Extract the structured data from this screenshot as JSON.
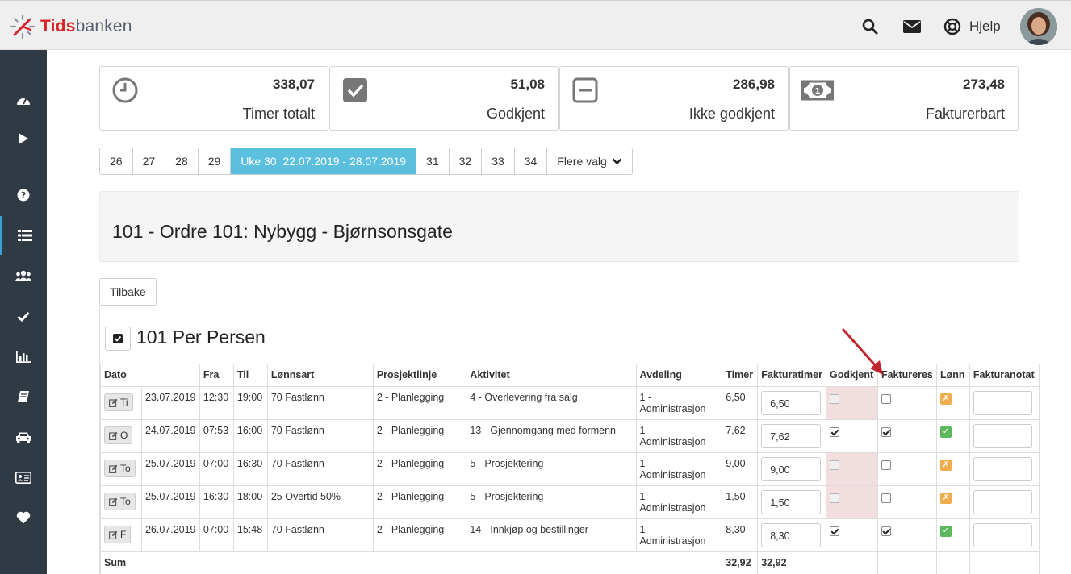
{
  "header": {
    "logo_brand": "Tids",
    "logo_rest": "banken",
    "help_label": "Hjelp",
    "icons": [
      "search-icon",
      "envelope-icon",
      "lifebuoy-icon"
    ]
  },
  "sidebar": {
    "items": [
      "dashboard-icon",
      "play-icon",
      "question-icon",
      "list-icon",
      "users-icon",
      "check-icon",
      "bar-chart-icon",
      "book-icon",
      "car-icon",
      "id-card-icon",
      "heart-icon"
    ],
    "active_item": "list-icon",
    "accent_color": "#3aa0d8"
  },
  "stats": [
    {
      "value": "338,07",
      "label": "Timer totalt",
      "icon": "clock-icon"
    },
    {
      "value": "51,08",
      "label": "Godkjent",
      "icon": "check-square-icon"
    },
    {
      "value": "286,98",
      "label": "Ikke godkjent",
      "icon": "minus-square-icon"
    },
    {
      "value": "273,48",
      "label": "Fakturerbart",
      "icon": "money-icon"
    }
  ],
  "pager": {
    "weeks_before": [
      "26",
      "27",
      "28",
      "29"
    ],
    "active": "Uke 30  22.07.2019 - 28.07.2019",
    "weeks_after": [
      "31",
      "32",
      "33",
      "34"
    ],
    "more": "Flere valg",
    "active_color": "#5bc0de"
  },
  "order": {
    "title": "101 - Ordre 101: Nybygg - Bjørnsonsgate"
  },
  "back_button": "Tilbake",
  "person": {
    "title": "101 Per Persen"
  },
  "table": {
    "headers": [
      "Dato",
      "Fra",
      "Til",
      "Lønnsart",
      "Prosjektlinje",
      "Aktivitet",
      "Avdeling",
      "Timer",
      "Fakturatimer",
      "Godkjent",
      "Faktureres",
      "Lønn",
      "Fakturanotat"
    ],
    "rows": [
      {
        "day": "Ti",
        "date": "23.07.2019",
        "fra": "12:30",
        "til": "19:00",
        "lonnsart": "70 Fastlønn",
        "prosjektlinje": "2 - Planlegging",
        "aktivitet": "4 - Overlevering fra salg",
        "avdeling": "1 - Administrasjon",
        "timer": "6,50",
        "fakturatimer": "6,50",
        "godkjent": false,
        "faktureres": false,
        "lonn": "warn"
      },
      {
        "day": "O",
        "date": "24.07.2019",
        "fra": "07:53",
        "til": "16:00",
        "lonnsart": "70 Fastlønn",
        "prosjektlinje": "2 - Planlegging",
        "aktivitet": "13 - Gjennomgang med formenn",
        "avdeling": "1 - Administrasjon",
        "timer": "7,62",
        "fakturatimer": "7,62",
        "godkjent": true,
        "faktureres": true,
        "lonn": "ok"
      },
      {
        "day": "To",
        "date": "25.07.2019",
        "fra": "07:00",
        "til": "16:30",
        "lonnsart": "70 Fastlønn",
        "prosjektlinje": "2 - Planlegging",
        "aktivitet": "5 - Prosjektering",
        "avdeling": "1 - Administrasjon",
        "timer": "9,00",
        "fakturatimer": "9,00",
        "godkjent": false,
        "faktureres": false,
        "lonn": "warn"
      },
      {
        "day": "To",
        "date": "25.07.2019",
        "fra": "16:30",
        "til": "18:00",
        "lonnsart": "25 Overtid 50%",
        "prosjektlinje": "2 - Planlegging",
        "aktivitet": "5 - Prosjektering",
        "avdeling": "1 - Administrasjon",
        "timer": "1,50",
        "fakturatimer": "1,50",
        "godkjent": false,
        "faktureres": false,
        "lonn": "warn"
      },
      {
        "day": "F",
        "date": "26.07.2019",
        "fra": "07:00",
        "til": "15:48",
        "lonnsart": "70 Fastlønn",
        "prosjektlinje": "2 - Planlegging",
        "aktivitet": "14 - Innkjøp og bestillinger",
        "avdeling": "1 - Administrasjon",
        "timer": "8,30",
        "fakturatimer": "8,30",
        "godkjent": true,
        "faktureres": true,
        "lonn": "ok"
      }
    ],
    "sum_label": "Sum",
    "sum_timer": "32,92",
    "sum_fakturatimer": "32,92",
    "lonn_warn_glyph": "✗",
    "lonn_ok_glyph": "✓"
  }
}
